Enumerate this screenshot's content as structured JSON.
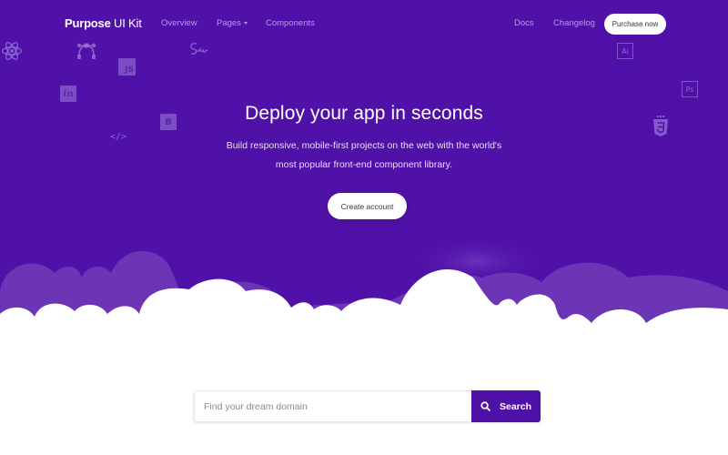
{
  "brand": {
    "bold": "Purpose",
    "rest": " UI Kit"
  },
  "nav": {
    "left": [
      {
        "label": "Overview"
      },
      {
        "label": "Pages",
        "has_dropdown": true
      },
      {
        "label": "Components"
      }
    ],
    "right": [
      {
        "label": "Docs"
      },
      {
        "label": "Changelog"
      }
    ],
    "purchase_label": "Purchase now"
  },
  "hero": {
    "title": "Deploy your app in seconds",
    "subtitle_line1": "Build responsive, mobile-first projects on the web with the world's",
    "subtitle_line2": "most popular front-end component library.",
    "cta_label": "Create account"
  },
  "decor_icons": {
    "js": "JS",
    "invision": "in",
    "bootstrap": "B",
    "illustrator": "Ai",
    "photoshop": "Ps",
    "code": "</>",
    "css3": "3"
  },
  "search": {
    "placeholder": "Find your dream domain",
    "value": "",
    "button_label": "Search"
  },
  "colors": {
    "brand_purple": "#5011a8",
    "white": "#ffffff",
    "cloud_back": "#6c35b6"
  }
}
